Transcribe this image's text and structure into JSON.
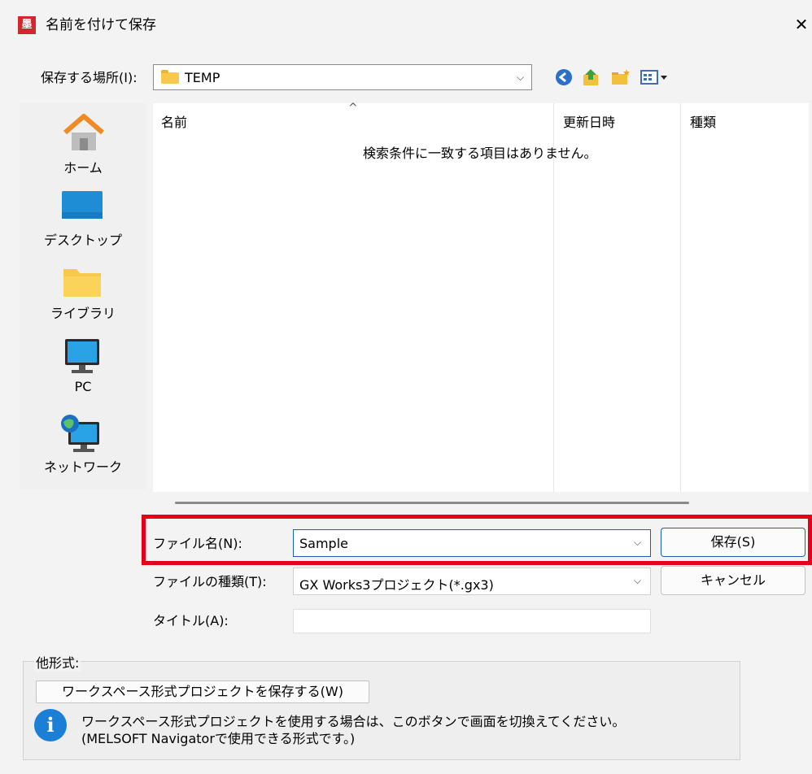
{
  "window": {
    "title": "名前を付けて保存",
    "app_icon_text": "墨",
    "close_glyph": "✕"
  },
  "savein": {
    "label": "保存する場所(I):",
    "value": "TEMP"
  },
  "places": [
    {
      "label": "ホーム",
      "icon": "home-icon"
    },
    {
      "label": "デスクトップ",
      "icon": "desktop-icon"
    },
    {
      "label": "ライブラリ",
      "icon": "library-folder-icon"
    },
    {
      "label": "PC",
      "icon": "pc-monitor-icon"
    },
    {
      "label": "ネットワーク",
      "icon": "network-icon"
    }
  ],
  "filelist": {
    "columns": [
      "名前",
      "更新日時",
      "種類"
    ],
    "empty_message": "検索条件に一致する項目はありません。"
  },
  "form": {
    "filename_label": "ファイル名(N):",
    "filename_value": "Sample",
    "filetype_label": "ファイルの種類(T):",
    "filetype_value": "GX Works3プロジェクト(*.gx3)",
    "title_label": "タイトル(A):",
    "title_value": "",
    "save_button": "保存(S)",
    "cancel_button": "キャンセル"
  },
  "other_format": {
    "group_label": "他形式:",
    "workspace_button": "ワークスペース形式プロジェクトを保存する(W)",
    "info_line1": "ワークスペース形式プロジェクトを使用する場合は、このボタンで画面を切換えてください。",
    "info_line2": "(MELSOFT Navigatorで使用できる形式です。)",
    "info_icon_glyph": "i"
  },
  "colors": {
    "highlight": "#e5001a",
    "folder": "#f7c84b",
    "accent": "#1c7fd6"
  }
}
